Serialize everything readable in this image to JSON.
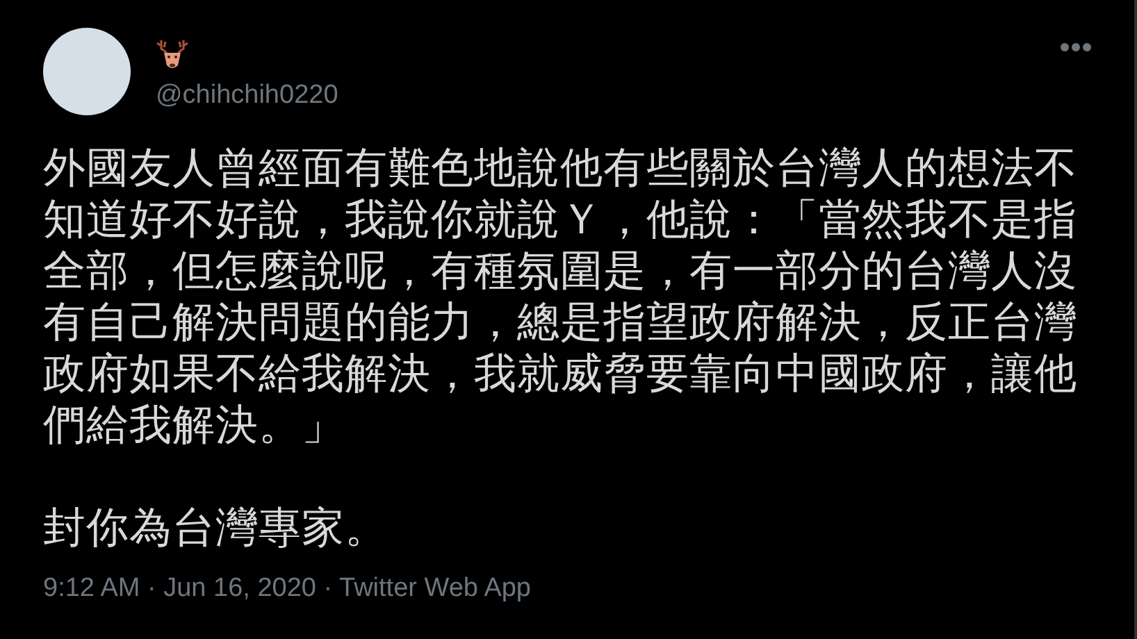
{
  "tweet": {
    "handle": "@chihchih0220",
    "paragraphs": [
      {
        "lines": [
          "外國友人曾經面有難色地說他有些關於台灣人的想法不",
          "知道好不好說，我說你就說Ｙ，他說：「當然我不是指",
          "全部，但怎麼說呢，有種氛圍是，有一部分的台灣人沒",
          "有自己解決問題的能力，總是指望政府解決，反正台灣",
          "政府如果不給我解決，我就威脅要靠向中國政府，讓他",
          "們給我解決。」"
        ]
      },
      {
        "lines": [
          "封你為台灣專家。"
        ]
      }
    ],
    "meta": "9:12 AM · Jun 16, 2020 · Twitter Web App"
  }
}
